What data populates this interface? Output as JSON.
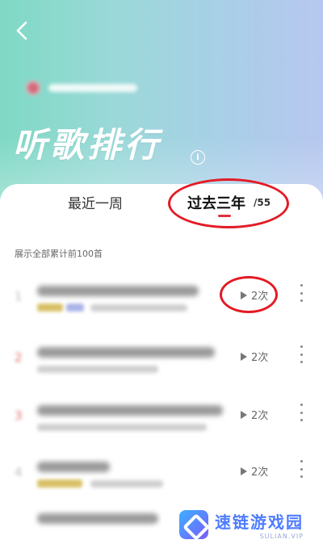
{
  "header": {
    "title": "听歌排行",
    "info_glyph": "i"
  },
  "tabs": [
    {
      "label": "最近一周",
      "active": false
    },
    {
      "label": "过去三年",
      "active": true,
      "count": "/55"
    }
  ],
  "subtitle": "展示全部累计前100首",
  "songs": [
    {
      "play_count": "2次"
    },
    {
      "play_count": "2次"
    },
    {
      "play_count": "2次"
    },
    {
      "play_count": "2次"
    }
  ],
  "watermark": {
    "main": "速链游戏园",
    "sub": "SULIAN.VIP"
  },
  "colors": {
    "accent_red": "#e31b25",
    "tab_underline": "#e0303a",
    "header_gradient_start": "#7fd9c4",
    "header_gradient_end": "#b7c7ef"
  }
}
